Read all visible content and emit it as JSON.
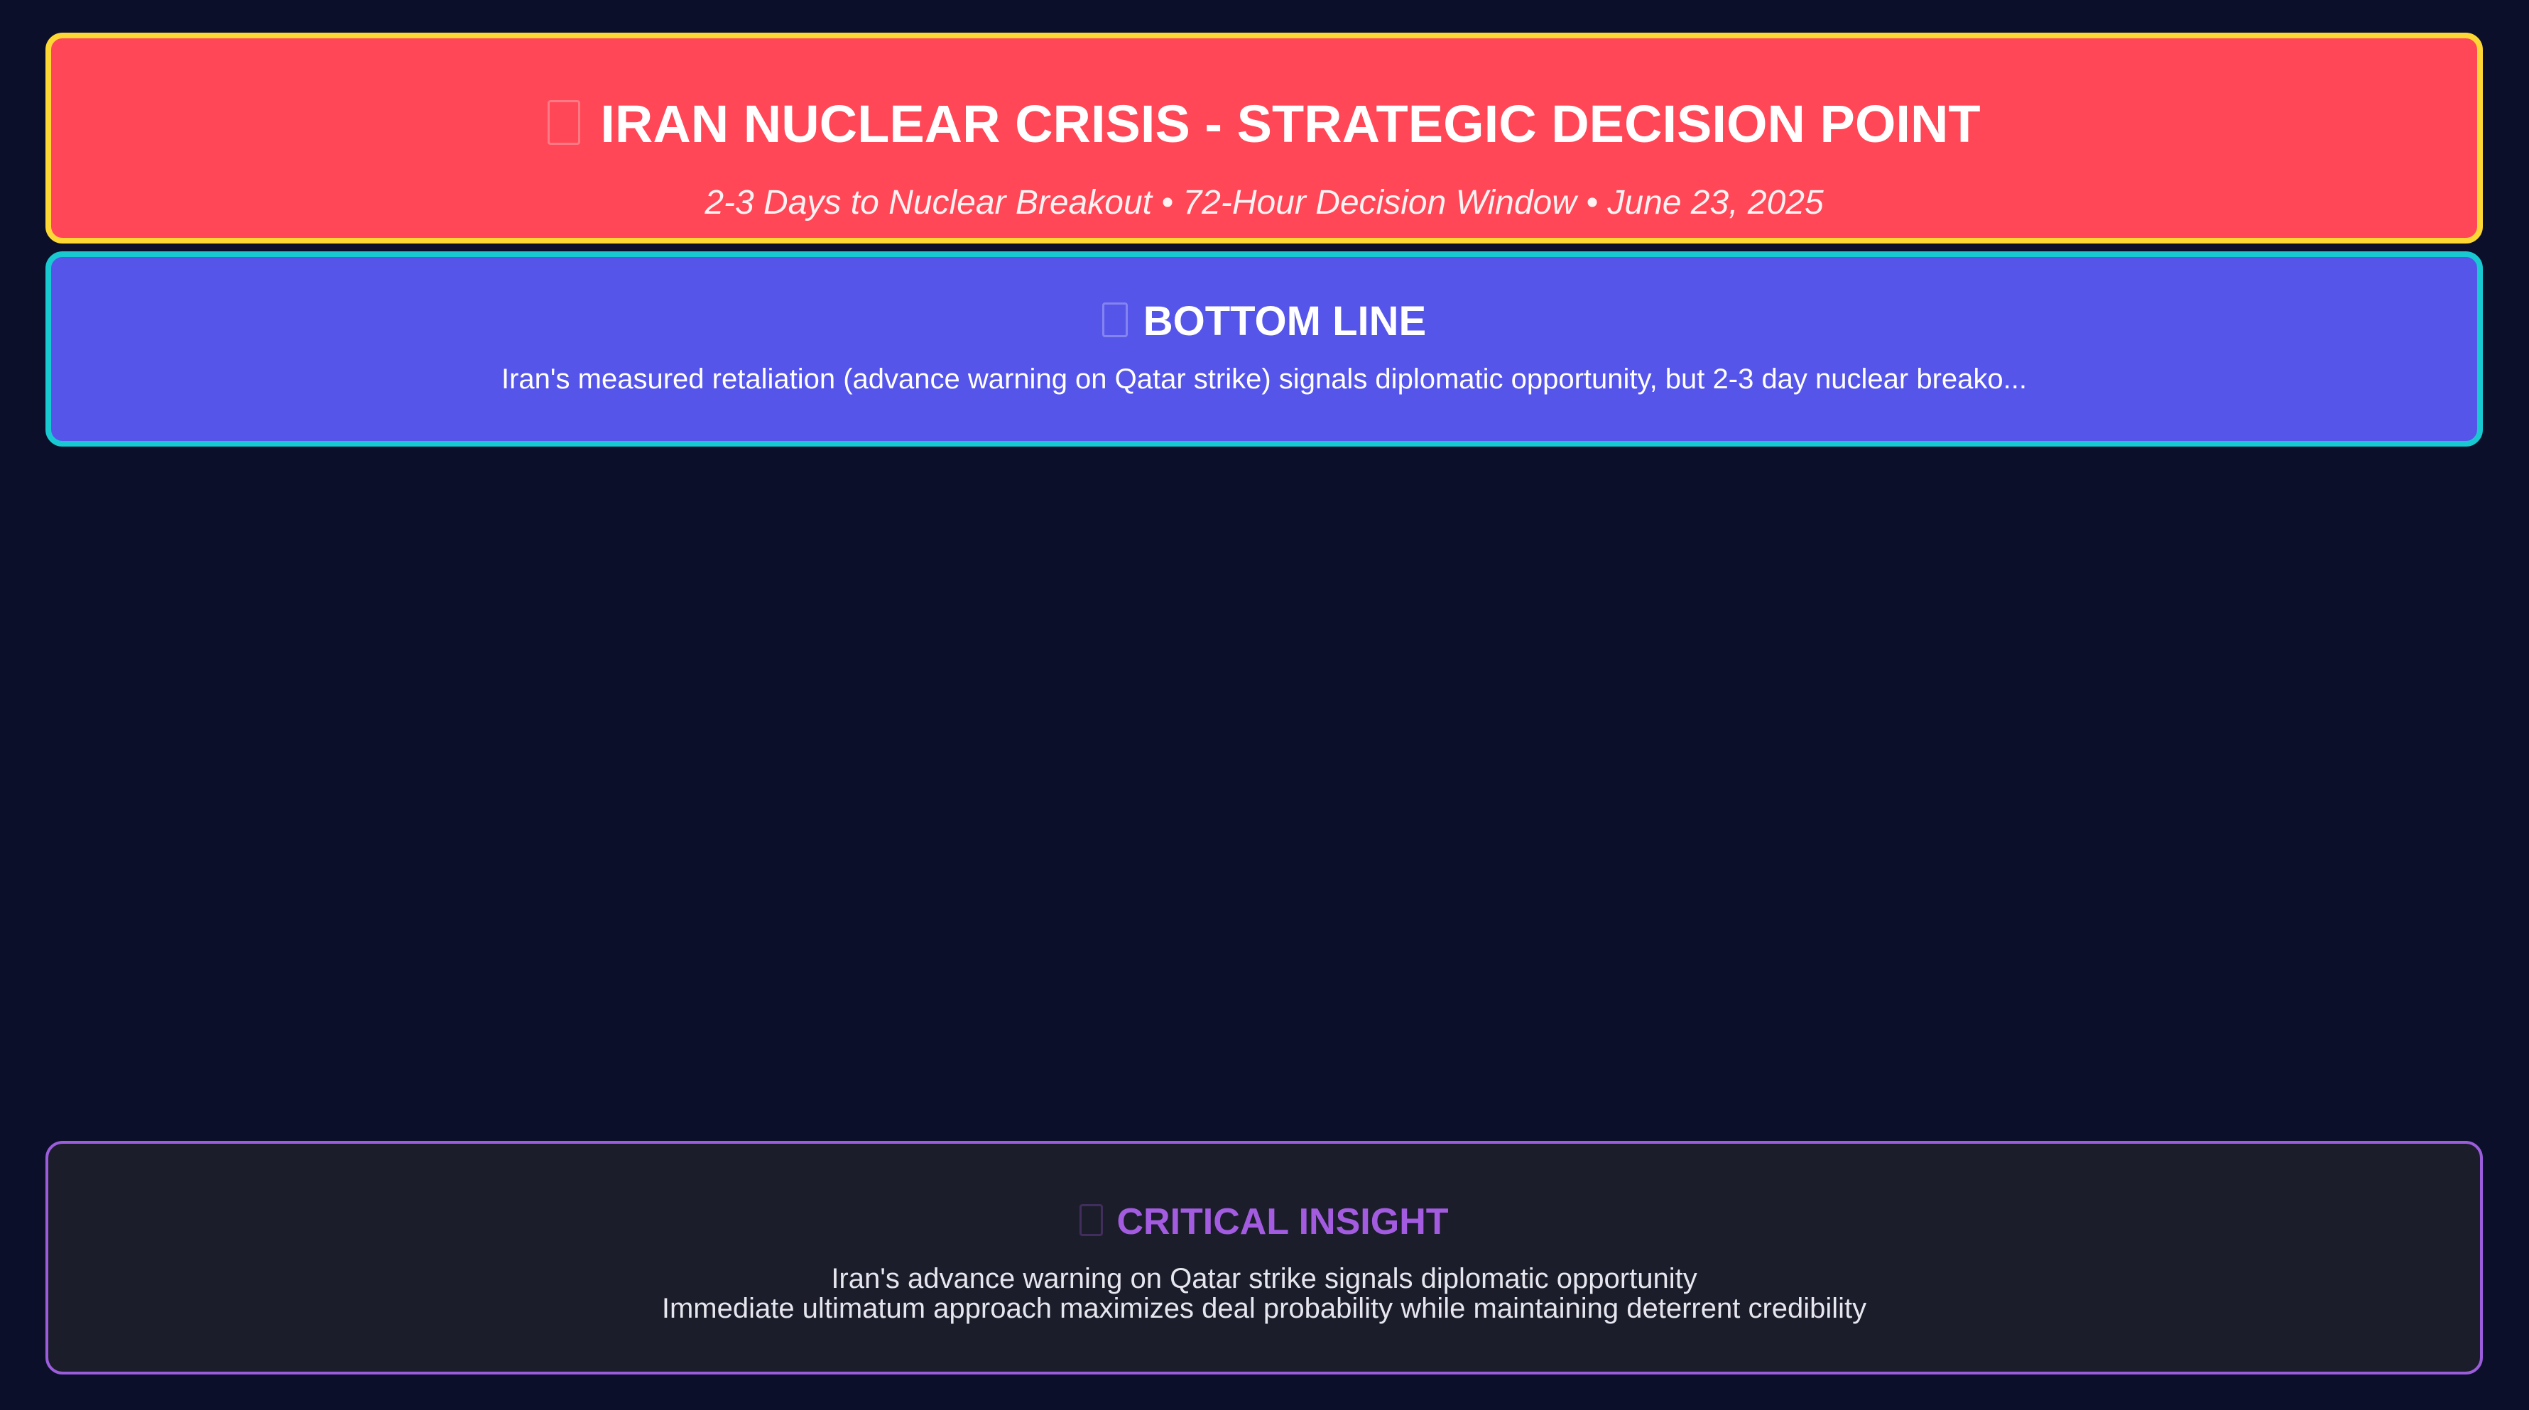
{
  "header": {
    "icon": "missing-glyph-icon",
    "title": "IRAN NUCLEAR CRISIS - STRATEGIC DECISION POINT",
    "subtitle": "2-3 Days to Nuclear Breakout • 72-Hour Decision Window • June 23, 2025"
  },
  "bottom_line": {
    "icon": "missing-glyph-icon",
    "title": "BOTTOM LINE",
    "text": "Iran's measured retaliation (advance warning on Qatar strike) signals diplomatic opportunity, but 2-3 day nuclear breako..."
  },
  "critical_insight": {
    "icon": "missing-glyph-icon",
    "title": "CRITICAL INSIGHT",
    "lines": [
      "Iran's advance warning on Qatar strike signals diplomatic opportunity",
      "Immediate ultimatum approach maximizes deal probability while maintaining deterrent credibility"
    ]
  },
  "colors": {
    "background": "#0b0f29",
    "header_bg": "#ff4757",
    "header_border": "#fdd835",
    "bottom_line_bg": "#5555ea",
    "bottom_line_border": "#18c9d2",
    "insight_bg": "#1c1d2b",
    "insight_border": "#9b5ddc",
    "insight_title": "#a35ce0"
  }
}
